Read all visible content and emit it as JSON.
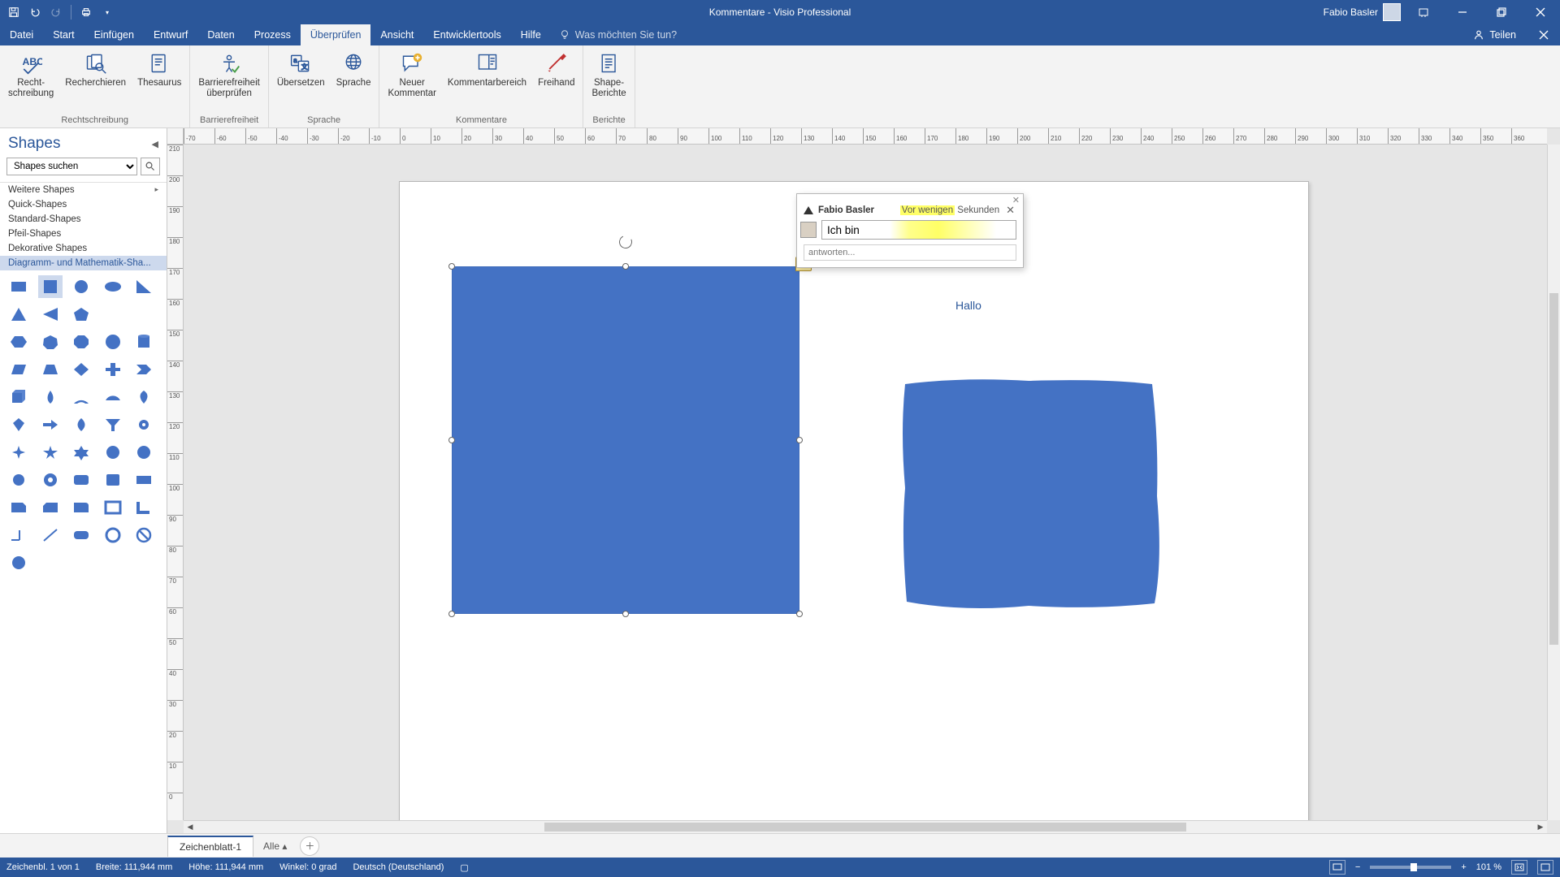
{
  "title": {
    "doc": "Kommentare",
    "sep": "  -  ",
    "app": "Visio Professional"
  },
  "user": {
    "name": "Fabio Basler"
  },
  "qat": {
    "save": "Speichern",
    "undo": "Rückgängig",
    "redo": "Wiederholen",
    "print": "Drucken"
  },
  "tabs": {
    "file": "Datei",
    "items": [
      "Start",
      "Einfügen",
      "Entwurf",
      "Daten",
      "Prozess",
      "Überprüfen",
      "Ansicht",
      "Entwicklertools",
      "Hilfe"
    ],
    "active": "Überprüfen",
    "tellme": "Was möchten Sie tun?",
    "share": "Teilen"
  },
  "ribbon": {
    "spellcheck": {
      "spell": "Recht-\nschreibung",
      "research": "Recherchieren",
      "thesaurus": "Thesaurus",
      "group": "Rechtschreibung"
    },
    "accessibility": {
      "check": "Barrierefreiheit\nüberprüfen",
      "group": "Barrierefreiheit"
    },
    "language": {
      "translate": "Übersetzen",
      "language": "Sprache",
      "group": "Sprache"
    },
    "comments": {
      "new": "Neuer\nKommentar",
      "pane": "Kommentarbereich",
      "ink": "Freihand",
      "group": "Kommentare"
    },
    "reports": {
      "shape": "Shape-\nBerichte",
      "group": "Berichte"
    }
  },
  "shapes_panel": {
    "title": "Shapes",
    "search_placeholder": "Shapes suchen",
    "stencils": {
      "more": "Weitere Shapes",
      "quick": "Quick-Shapes",
      "standard": "Standard-Shapes",
      "arrow": "Pfeil-Shapes",
      "decorative": "Dekorative Shapes",
      "diagram": "Diagramm- und Mathematik-Sha..."
    }
  },
  "comment": {
    "author": "Fabio Basler",
    "time_hl": "Vor wenigen",
    "time_rest": " Sekunden",
    "text": "Ich bin ",
    "reply_placeholder": "antworten..."
  },
  "canvas": {
    "hallo": "Hallo",
    "blue": "#4472c4"
  },
  "sheets": {
    "page1": "Zeichenblatt-1",
    "all": "Alle ▴"
  },
  "status": {
    "page": "Zeichenbl. 1 von 1",
    "width": "Breite: 111,944 mm",
    "height": "Höhe: 111,944 mm",
    "angle": "Winkel: 0 grad",
    "lang": "Deutsch (Deutschland)",
    "zoom": "101 %"
  },
  "hruler_ticks": [
    -70,
    -60,
    -50,
    -40,
    -30,
    -20,
    -10,
    0,
    10,
    20,
    30,
    40,
    50,
    60,
    70,
    80,
    90,
    100,
    110,
    120,
    130,
    140,
    150,
    160,
    170,
    180,
    190,
    200,
    210,
    220,
    230,
    240,
    250,
    260,
    270,
    280,
    290,
    300,
    310,
    320,
    330,
    340,
    350,
    360
  ],
  "vruler_ticks": [
    210,
    200,
    190,
    180,
    170,
    160,
    150,
    140,
    130,
    120,
    110,
    100,
    90,
    80,
    70,
    60,
    50,
    40,
    30,
    20,
    10,
    0
  ]
}
